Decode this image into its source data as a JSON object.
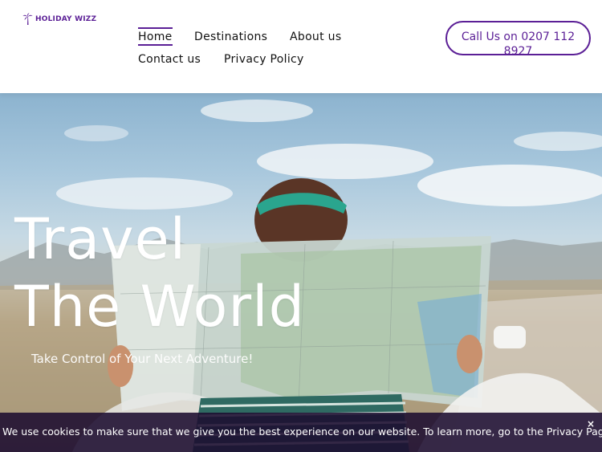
{
  "brand": {
    "name": "HOLIDAY WIZZ",
    "accent": "#5b1f96"
  },
  "nav": {
    "items": [
      {
        "label": "Home",
        "active": true
      },
      {
        "label": "Destinations",
        "active": false
      },
      {
        "label": "About us",
        "active": false
      },
      {
        "label": "Contact us",
        "active": false
      },
      {
        "label": "Privacy Policy",
        "active": false
      }
    ]
  },
  "call_button": {
    "label": "Call Us on 0207 112 8927"
  },
  "hero": {
    "headline_line1": "Travel",
    "headline_line2": "The World",
    "subheadline": "Take Control of Your Next Adventure!"
  },
  "cookie_banner": {
    "text": "We use cookies to make sure that we give you the best experience on our website. To learn more, go to the Privacy Page.",
    "close_label": "×"
  }
}
